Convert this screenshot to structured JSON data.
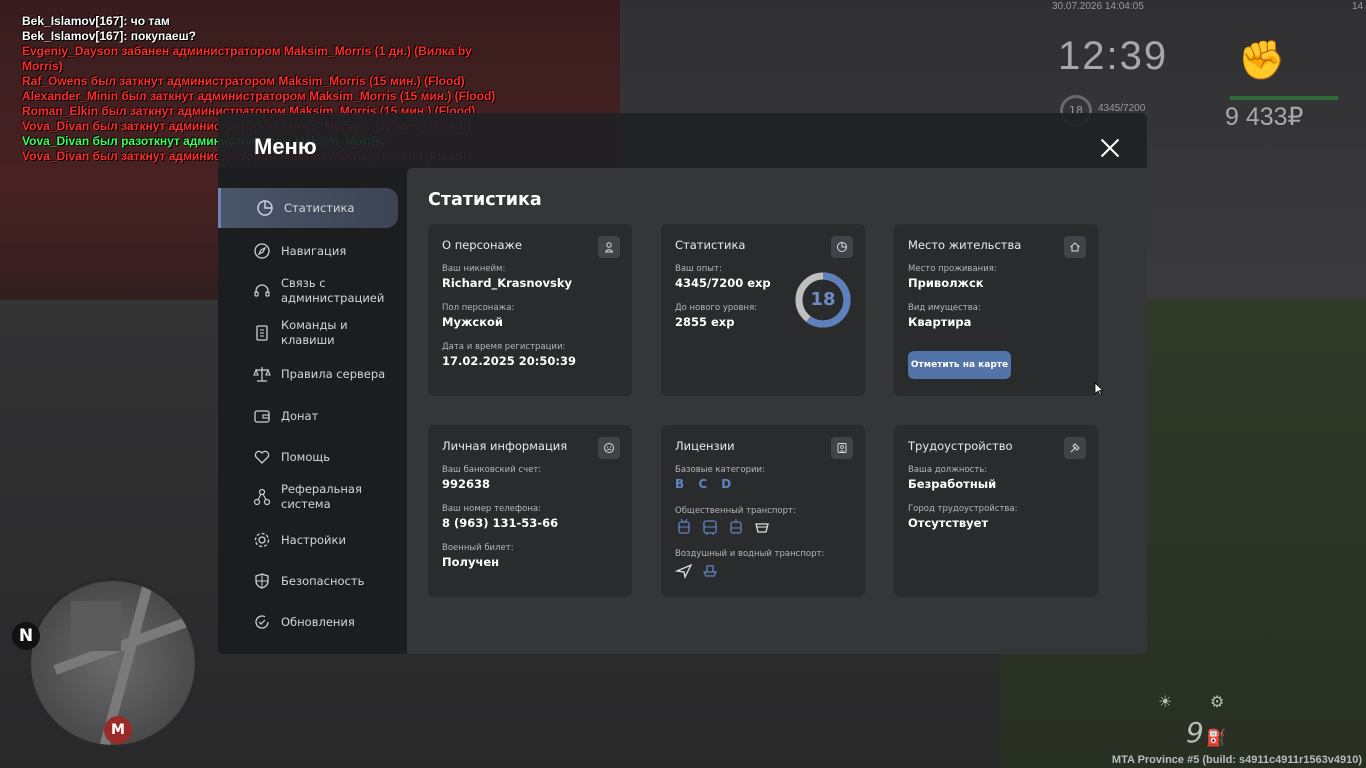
{
  "chat": [
    {
      "text": "Bek_Islamov[167]: чо там",
      "color": "white"
    },
    {
      "text": "Bek_Islamov[167]: покупаеш?",
      "color": "white"
    },
    {
      "text": "Evgeniy_Dayson забанен администратором Maksim_Morris (1 дн.) (Вилка by",
      "color": "red"
    },
    {
      "text": "Morris)",
      "color": "red"
    },
    {
      "text": "Raf_Owens был заткнут администратором Maksim_Morris (15 мин.) (Flood)",
      "color": "red"
    },
    {
      "text": "Alexander_Minin был заткнут администратором Maksim_Morris (15 мин.) (Flood)",
      "color": "red"
    },
    {
      "text": "Roman_Elkin был заткнут администратором Maksim_Morris (15 мин.) (Flood)",
      "color": "red"
    },
    {
      "text": "Vova_Divan был заткнут администратором James_Moriarty (10 мин.) (Flood)",
      "color": "red"
    },
    {
      "text": "Vova_Divan был разоткнут администратором Maksim_Morris.",
      "color": "green"
    },
    {
      "text": "Vova_Divan был заткнут администратором Maksim_Morris (15 мин.) (Flood)",
      "color": "red"
    }
  ],
  "hud": {
    "datetime": "30.07.2026 14:04:05",
    "corner": "14",
    "clock": "12:39",
    "level": "18",
    "exp": "4345/7200",
    "money": "9 433₽",
    "speed": "9",
    "build": "MTA Province #5 (build: s4911c4911r1563v4910)",
    "map_north": "N",
    "map_marker": "M"
  },
  "menu": {
    "title": "Меню",
    "nav": [
      {
        "label": "Статистика",
        "icon": "pie-chart-icon",
        "active": true
      },
      {
        "label": "Навигация",
        "icon": "compass-icon"
      },
      {
        "label": "Связь с администрацией",
        "icon": "headset-icon"
      },
      {
        "label": "Команды и клавиши",
        "icon": "document-icon"
      },
      {
        "label": "Правила сервера",
        "icon": "scales-icon"
      },
      {
        "label": "Донат",
        "icon": "wallet-icon"
      },
      {
        "label": "Помощь",
        "icon": "heart-hand-icon"
      },
      {
        "label": "Реферальная система",
        "icon": "referral-icon"
      },
      {
        "label": "Настройки",
        "icon": "gear-icon"
      },
      {
        "label": "Безопасность",
        "icon": "shield-icon"
      },
      {
        "label": "Обновления",
        "icon": "refresh-icon"
      }
    ]
  },
  "content": {
    "title": "Статистика",
    "character": {
      "title": "О персонаже",
      "nickname_label": "Ваш никнейм:",
      "nickname": "Richard_Krasnovsky",
      "gender_label": "Пол персонажа:",
      "gender": "Мужской",
      "reg_label": "Дата и время регистрации:",
      "reg": "17.02.2025 20:50:39"
    },
    "stats": {
      "title": "Статистика",
      "exp_label": "Ваш опыт:",
      "exp": "4345/7200 exp",
      "next_label": "До нового уровня:",
      "next": "2855 exp",
      "level": "18",
      "progress": 0.6035,
      "accent": "#5e80bd"
    },
    "residence": {
      "title": "Место жительства",
      "place_label": "Место проживания:",
      "place": "Приволжск",
      "property_label": "Вид имущества:",
      "property": "Квартира",
      "button": "Отметить на карте"
    },
    "personal": {
      "title": "Личная информация",
      "bank_label": "Ваш банковский счет:",
      "bank": "992638",
      "phone_label": "Ваш номер телефона:",
      "phone": "8 (963) 131-53-66",
      "military_label": "Военный билет:",
      "military": "Получен"
    },
    "licenses": {
      "title": "Лицензии",
      "base_label": "Базовые категории:",
      "base": "B C D",
      "public_label": "Общественный транспорт:",
      "air_label": "Воздушный и водный транспорт:"
    },
    "job": {
      "title": "Трудоустройство",
      "position_label": "Ваша должность:",
      "position": "Безработный",
      "city_label": "Город трудоустройства:",
      "city": "Отсутствует"
    }
  }
}
